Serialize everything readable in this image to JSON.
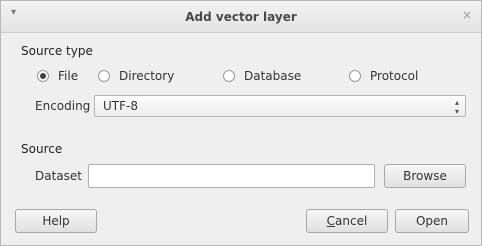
{
  "window": {
    "title": "Add vector layer",
    "menu_glyph": "▾",
    "close_glyph": "×"
  },
  "source_type": {
    "heading": "Source type",
    "options": [
      {
        "label": "File",
        "checked": true
      },
      {
        "label": "Directory",
        "checked": false
      },
      {
        "label": "Database",
        "checked": false
      },
      {
        "label": "Protocol",
        "checked": false
      }
    ],
    "encoding_label": "Encoding",
    "encoding_value": "UTF-8"
  },
  "source": {
    "heading": "Source",
    "dataset_label": "Dataset",
    "dataset_value": "",
    "browse_label": "Browse"
  },
  "buttons": {
    "help": "Help",
    "cancel_first": "C",
    "cancel_rest": "ancel",
    "open": "Open"
  }
}
